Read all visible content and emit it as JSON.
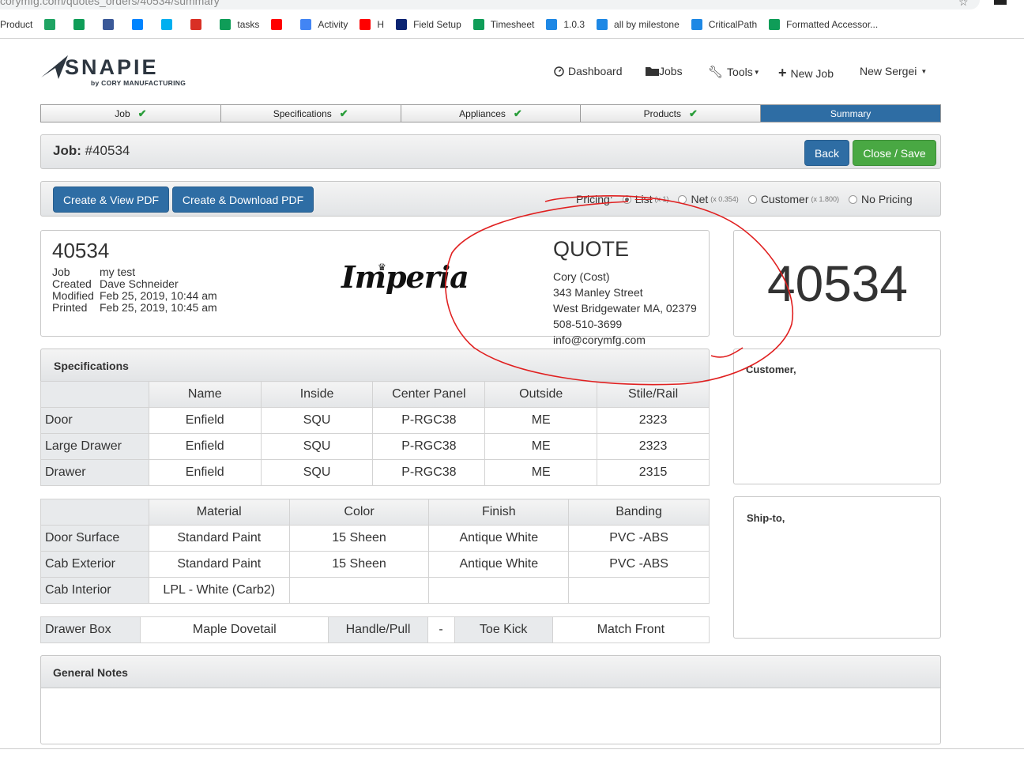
{
  "browser": {
    "url": "corymfg.com/quotes_orders/40534/summary",
    "bookmarks": [
      {
        "label": "Product",
        "icon": "none",
        "color": ""
      },
      {
        "label": "",
        "icon": "drive-icon",
        "color": "#1fa463"
      },
      {
        "label": "",
        "icon": "hangouts-icon",
        "color": "#0f9d58"
      },
      {
        "label": "",
        "icon": "facebook-icon",
        "color": "#3b5998"
      },
      {
        "label": "",
        "icon": "messenger-icon",
        "color": "#0084ff"
      },
      {
        "label": "",
        "icon": "skype-icon",
        "color": "#00aff0"
      },
      {
        "label": "",
        "icon": "gmail-icon",
        "color": "#d93025"
      },
      {
        "label": "tasks",
        "icon": "sheets-icon",
        "color": "#0f9d58"
      },
      {
        "label": "",
        "icon": "youtube-icon",
        "color": "#ff0000"
      },
      {
        "label": "Activity",
        "icon": "google-icon",
        "color": "#4285f4"
      },
      {
        "label": "H",
        "icon": "youtube-icon",
        "color": "#ff0000"
      },
      {
        "label": "Field Setup",
        "icon": "ieee-icon",
        "color": "#0a2472"
      },
      {
        "label": "Timesheet",
        "icon": "sheets-icon",
        "color": "#0f9d58"
      },
      {
        "label": "1.0.3",
        "icon": "shield-icon",
        "color": "#1e88e5"
      },
      {
        "label": "all by milestone",
        "icon": "shield-icon",
        "color": "#1e88e5"
      },
      {
        "label": "CriticalPath",
        "icon": "shield-icon",
        "color": "#1e88e5"
      },
      {
        "label": "Formatted Accessor...",
        "icon": "sheets-icon",
        "color": "#0f9d58"
      }
    ]
  },
  "brand": {
    "name": "SNAPIE",
    "sub": "by CORY MANUFACTURING"
  },
  "nav": {
    "dashboard": "Dashboard",
    "jobs": "Jobs",
    "tools": "Tools",
    "new_job": "New Job",
    "user": "New Sergei"
  },
  "wizard": [
    {
      "label": "Job",
      "done": true
    },
    {
      "label": "Specifications",
      "done": true
    },
    {
      "label": "Appliances",
      "done": true
    },
    {
      "label": "Products",
      "done": true
    },
    {
      "label": "Summary",
      "done": false
    }
  ],
  "job": {
    "title_label": "Job:",
    "title_value": "#40534",
    "back": "Back",
    "close_save": "Close / Save"
  },
  "pdf": {
    "view": "Create & View PDF",
    "download": "Create & Download PDF"
  },
  "pricing": {
    "label": "Pricing:",
    "options": [
      {
        "label": "List",
        "mult": "(x 1)",
        "selected": true
      },
      {
        "label": "Net",
        "mult": "(x 0.354)",
        "selected": false
      },
      {
        "label": "Customer",
        "mult": "(x 1.800)",
        "selected": false
      },
      {
        "label": "No Pricing",
        "mult": "",
        "selected": false
      }
    ]
  },
  "header": {
    "number": "40534",
    "meta": [
      {
        "k": "Job",
        "v": "my test"
      },
      {
        "k": "Created",
        "v": "Dave Schneider"
      },
      {
        "k": "Modified",
        "v": "Feb 25, 2019, 10:44 am"
      },
      {
        "k": "Printed",
        "v": "Feb 25, 2019, 10:45 am"
      }
    ],
    "logo": "Imperia",
    "quote_title": "QUOTE",
    "address": [
      "Cory (Cost)",
      "343 Manley Street",
      "West Bridgewater MA, 02379",
      "508-510-3699",
      "info@corymfg.com"
    ],
    "big_number": "40534"
  },
  "specifications": {
    "title": "Specifications",
    "columns": [
      "Name",
      "Inside",
      "Center Panel",
      "Outside",
      "Stile/Rail"
    ],
    "rows": [
      {
        "label": "Door",
        "cells": [
          "Enfield",
          "SQU",
          "P-RGC38",
          "ME",
          "2323"
        ]
      },
      {
        "label": "Large Drawer",
        "cells": [
          "Enfield",
          "SQU",
          "P-RGC38",
          "ME",
          "2323"
        ]
      },
      {
        "label": "Drawer",
        "cells": [
          "Enfield",
          "SQU",
          "P-RGC38",
          "ME",
          "2315"
        ]
      }
    ]
  },
  "materials": {
    "columns": [
      "Material",
      "Color",
      "Finish",
      "Banding"
    ],
    "rows": [
      {
        "label": "Door Surface",
        "cells": [
          "Standard Paint",
          "15 Sheen",
          "Antique White",
          "PVC -ABS"
        ]
      },
      {
        "label": "Cab Exterior",
        "cells": [
          "Standard Paint",
          "15 Sheen",
          "Antique White",
          "PVC -ABS"
        ]
      },
      {
        "label": "Cab Interior",
        "cells": [
          "LPL - White (Carb2)",
          "",
          "",
          ""
        ]
      }
    ]
  },
  "extras": [
    "Drawer Box",
    "Maple Dovetail",
    "Handle/Pull",
    "-",
    "Toe Kick",
    "Match Front"
  ],
  "customer_title": "Customer,",
  "shipto_title": "Ship-to,",
  "notes_title": "General Notes",
  "annotation_color": "#e02020"
}
